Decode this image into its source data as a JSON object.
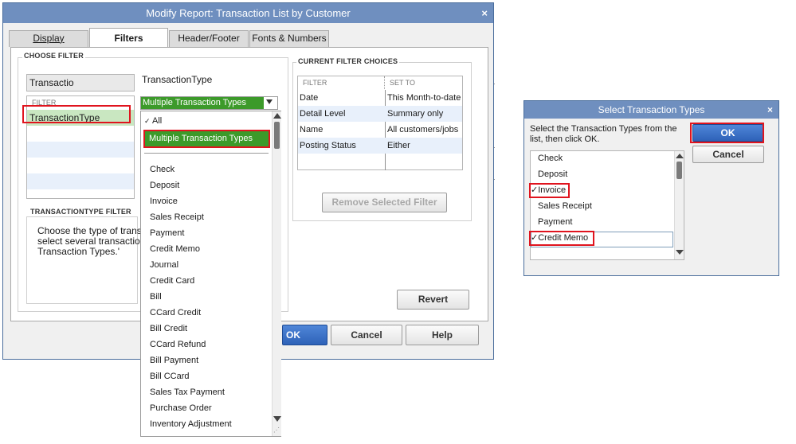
{
  "main_dialog": {
    "title": "Modify Report: Transaction List by Customer",
    "close_glyph": "×",
    "tabs": [
      "Display",
      "Filters",
      "Header/Footer",
      "Fonts & Numbers"
    ],
    "choose_filter_header": "CHOOSE FILTER",
    "search_value": "Transactio",
    "filter_col_header": "FILTER",
    "filter_list": [
      "TransactionType"
    ],
    "selected_filter_label": "TransactionType",
    "dropdown_value": "Multiple Transaction Types",
    "dropdown_options": [
      "All",
      "Multiple Transaction Types",
      "Check",
      "Deposit",
      "Invoice",
      "Sales Receipt",
      "Payment",
      "Credit Memo",
      "Journal",
      "Credit Card",
      "Bill",
      "CCard Credit",
      "Bill Credit",
      "CCard Refund",
      "Bill Payment",
      "Bill CCard",
      "Sales Tax Payment",
      "Purchase Order",
      "Inventory Adjustment"
    ],
    "all_check_glyph": "✓",
    "tt_filter_header": "TRANSACTIONTYPE FILTER",
    "tt_filter_desc": [
      "Choose the type of transacti",
      "select several transaction typ",
      "Transaction Types.'"
    ],
    "current_choices_header": "CURRENT FILTER CHOICES",
    "current_table": {
      "headers": [
        "FILTER",
        "SET TO"
      ],
      "rows": [
        [
          "Date",
          "This Month-to-date"
        ],
        [
          "Detail Level",
          "Summary only"
        ],
        [
          "Name",
          "All customers/jobs"
        ],
        [
          "Posting Status",
          "Either"
        ]
      ]
    },
    "remove_btn": "Remove Selected Filter",
    "revert_btn": "Revert",
    "ok_btn": "OK",
    "cancel_btn": "Cancel",
    "help_btn": "Help"
  },
  "select_dialog": {
    "title": "Select Transaction Types",
    "close_glyph": "×",
    "instruction_line1": "Select the Transaction Types from the",
    "instruction_line2": "list, then click OK.",
    "ok_btn": "OK",
    "cancel_btn": "Cancel",
    "items": [
      {
        "label": "Check",
        "checked": false
      },
      {
        "label": "Deposit",
        "checked": false
      },
      {
        "label": "Invoice",
        "checked": true
      },
      {
        "label": "Sales Receipt",
        "checked": false
      },
      {
        "label": "Payment",
        "checked": false
      },
      {
        "label": "Credit Memo",
        "checked": true
      }
    ],
    "check_glyph": "✓"
  },
  "colors": {
    "title_bar": "#6f8fbf",
    "highlight_red": "#e0141e",
    "selected_green": "#3c9a2a",
    "ok_blue": "#2e62b8"
  }
}
